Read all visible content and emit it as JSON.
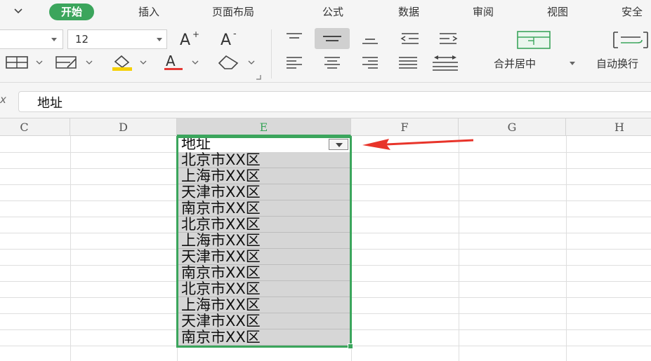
{
  "tabs": {
    "home": "开始",
    "insert": "插入",
    "page_layout": "页面布局",
    "formulas": "公式",
    "data": "数据",
    "review": "审阅",
    "view": "视图",
    "security": "安全"
  },
  "toolbar": {
    "font_size": "12",
    "merge_center": "合并居中",
    "wrap_text": "自动换行"
  },
  "formula_bar": {
    "value": "地址"
  },
  "columns": [
    "C",
    "D",
    "E",
    "F",
    "G",
    "H"
  ],
  "selected_column": "E",
  "column_e_cells": [
    "地址",
    "北京市XX区",
    "上海市XX区",
    "天津市XX区",
    "南京市XX区",
    "北京市XX区",
    "上海市XX区",
    "天津市XX区",
    "南京市XX区",
    "北京市XX区",
    "上海市XX区",
    "天津市XX区",
    "南京市XX区"
  ],
  "colors": {
    "accent_green": "#3ba55c",
    "annotation_red": "#e8342a",
    "underline_red": "#e53935",
    "fill_yellow": "#f5d000"
  },
  "icons": {
    "font_color": "A"
  }
}
